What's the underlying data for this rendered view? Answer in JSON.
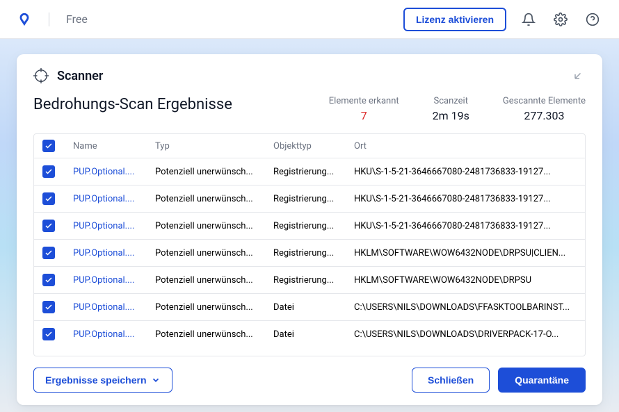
{
  "topbar": {
    "product_tier": "Free",
    "license_button": "Lizenz aktivieren"
  },
  "card": {
    "title": "Scanner",
    "results_title": "Bedrohungs-Scan Ergebnisse",
    "stats": {
      "detected_label": "Elemente erkannt",
      "detected_value": "7",
      "time_label": "Scanzeit",
      "time_value": "2m 19s",
      "scanned_label": "Gescannte Elemente",
      "scanned_value": "277.303"
    },
    "columns": {
      "name": "Name",
      "type": "Typ",
      "objtype": "Objekttyp",
      "location": "Ort"
    },
    "rows": [
      {
        "name": "PUP.Optional....",
        "type": "Potenziell unerwünsch...",
        "objtype": "Registrierung...",
        "location": "HKU\\S-1-5-21-3646667080-2481736833-19127..."
      },
      {
        "name": "PUP.Optional....",
        "type": "Potenziell unerwünsch...",
        "objtype": "Registrierung...",
        "location": "HKU\\S-1-5-21-3646667080-2481736833-19127..."
      },
      {
        "name": "PUP.Optional....",
        "type": "Potenziell unerwünsch...",
        "objtype": "Registrierung...",
        "location": "HKU\\S-1-5-21-3646667080-2481736833-19127..."
      },
      {
        "name": "PUP.Optional....",
        "type": "Potenziell unerwünsch...",
        "objtype": "Registrierung...",
        "location": "HKLM\\SOFTWARE\\WOW6432NODE\\DRPSU|CLIEN..."
      },
      {
        "name": "PUP.Optional....",
        "type": "Potenziell unerwünsch...",
        "objtype": "Registrierung...",
        "location": "HKLM\\SOFTWARE\\WOW6432NODE\\DRPSU"
      },
      {
        "name": "PUP.Optional....",
        "type": "Potenziell unerwünsch...",
        "objtype": "Datei",
        "location": "C:\\USERS\\NILS\\DOWNLOADS\\FFASKTOOLBARINST..."
      },
      {
        "name": "PUP.Optional....",
        "type": "Potenziell unerwünsch...",
        "objtype": "Datei",
        "location": "C:\\USERS\\NILS\\DOWNLOADS\\DRIVERPACK-17-O..."
      }
    ],
    "buttons": {
      "save": "Ergebnisse speichern",
      "close": "Schließen",
      "quarantine": "Quarantäne"
    }
  },
  "colors": {
    "primary": "#1d4ed8",
    "danger": "#dc2626"
  }
}
